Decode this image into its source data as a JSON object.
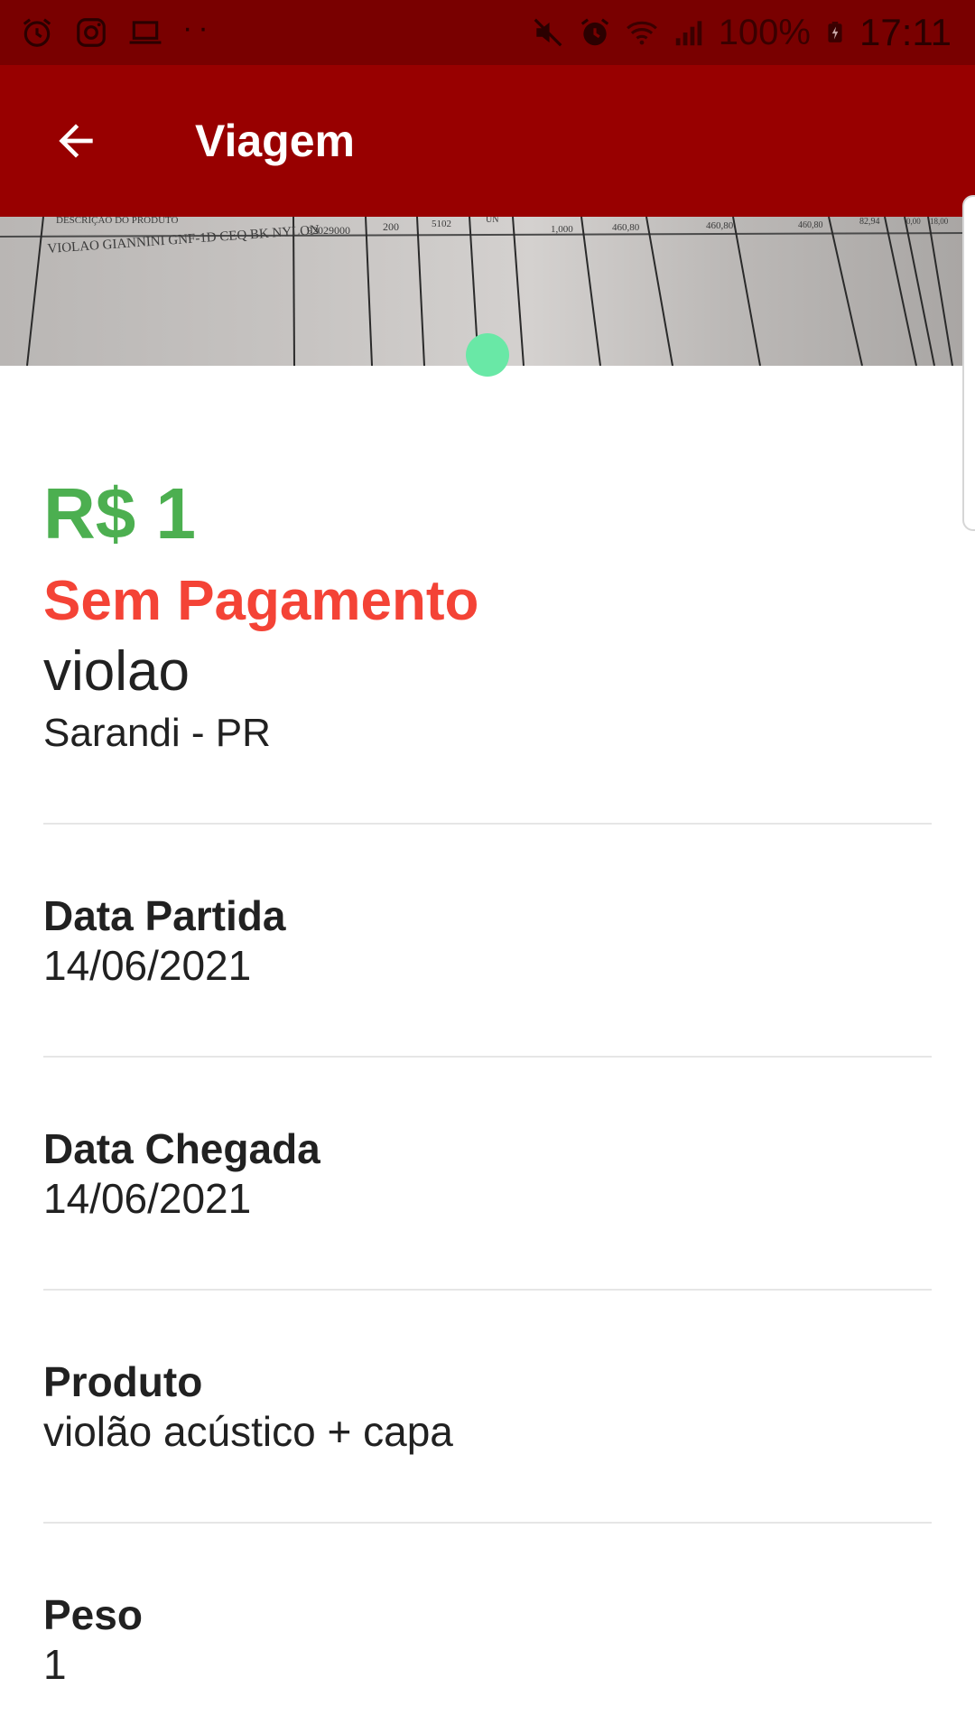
{
  "status_bar": {
    "left_icons": [
      "alarm-icon",
      "instagram-icon",
      "laptop-icon"
    ],
    "dots": "··",
    "right_icons": [
      "mute-icon",
      "alarm-icon",
      "wifi-icon",
      "signal-icon"
    ],
    "battery": "100%",
    "time": "17:11"
  },
  "app_bar": {
    "back_icon": "arrow-left-icon",
    "title": "Viagem"
  },
  "header_photo": {
    "texts": [
      "DESCRIÇÃO DO PRODUTO",
      "VIOLAO GIANNINI GNF-1D CEQ BK NYLON",
      "92029000",
      "200",
      "5102",
      "UN",
      "1,000",
      "460,80",
      "460,80",
      "460,80",
      "82,94",
      "0,00",
      "18,00"
    ]
  },
  "trip": {
    "price": "R$ 1",
    "payment_status": "Sem Pagamento",
    "name": "violao",
    "location": "Sarandi - PR"
  },
  "fields": [
    {
      "label": "Data Partida",
      "value": "14/06/2021"
    },
    {
      "label": "Data Chegada",
      "value": "14/06/2021"
    },
    {
      "label": "Produto",
      "value": "violão acústico + capa"
    },
    {
      "label": "Peso",
      "value": "1"
    }
  ],
  "colors": {
    "status_bar": "#790000",
    "app_bar": "#980000",
    "price": "#4caf50",
    "payment_status": "#f44336",
    "page_indicator": "#69e8a6"
  }
}
